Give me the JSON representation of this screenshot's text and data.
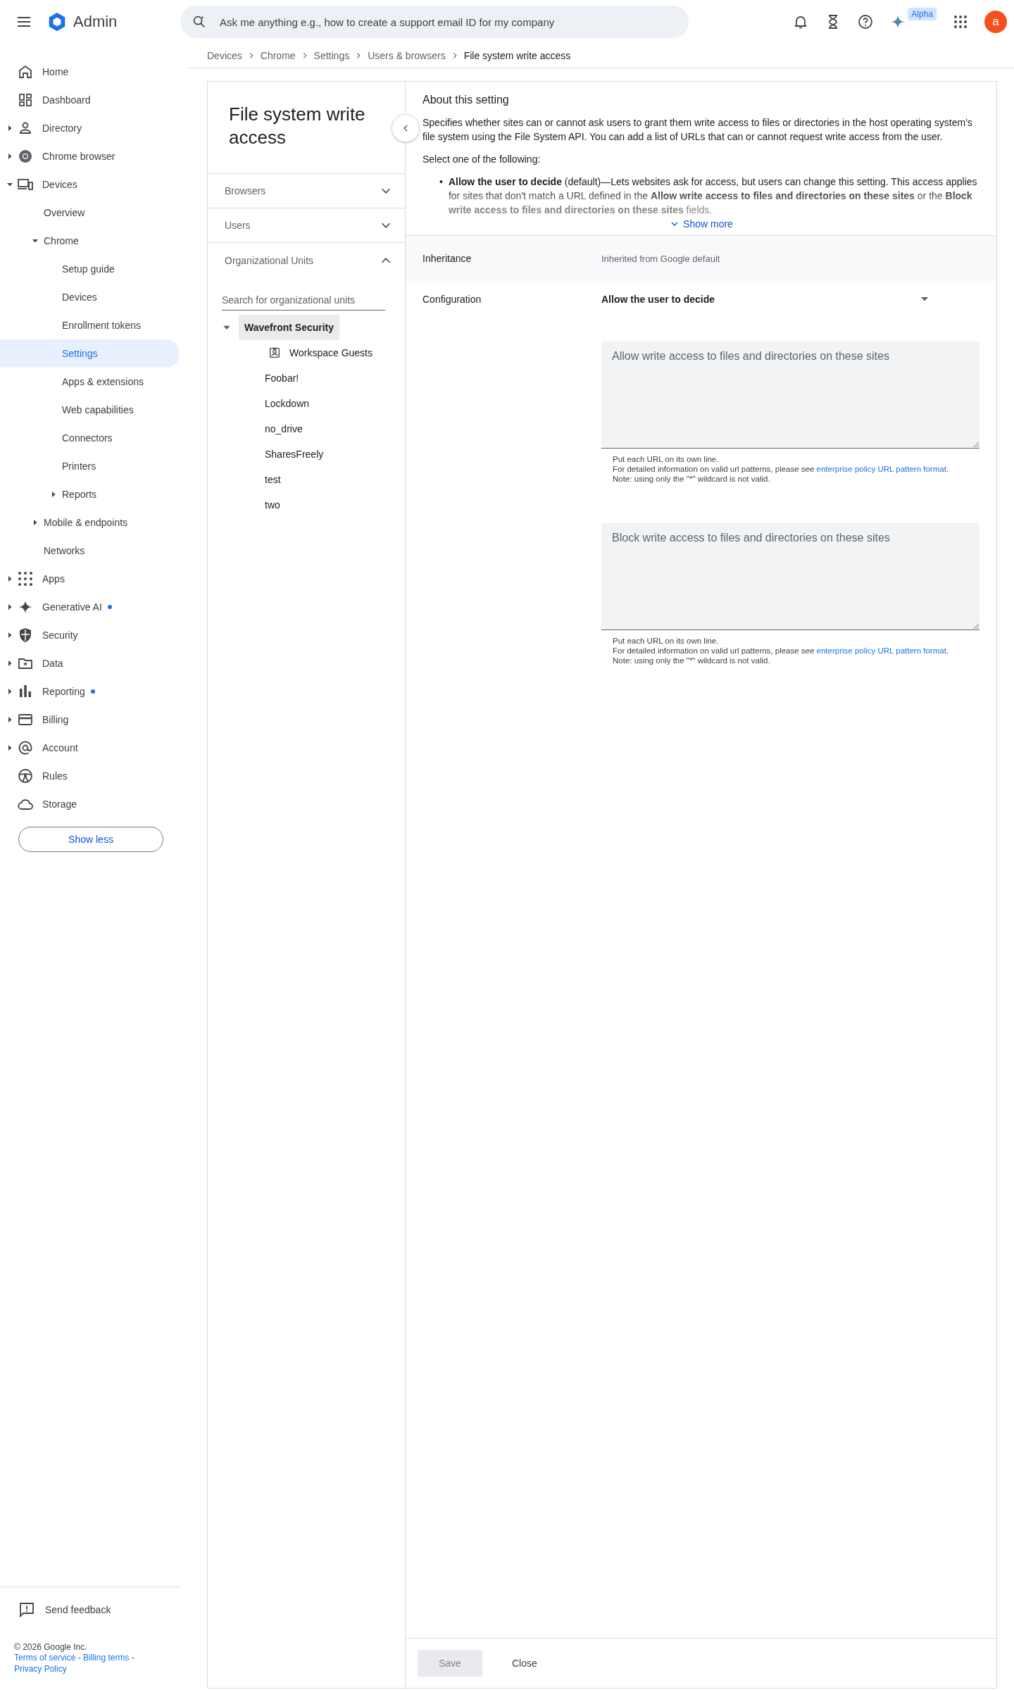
{
  "header": {
    "app_name": "Admin",
    "search": {
      "placeholder": "Ask me anything e.g., how to create a support email ID for my company"
    },
    "badge": "Alpha",
    "avatar_letter": "a"
  },
  "breadcrumb": [
    {
      "label": "Devices",
      "current": false
    },
    {
      "label": "Chrome",
      "current": false
    },
    {
      "label": "Settings",
      "current": false
    },
    {
      "label": "Users & browsers",
      "current": false
    },
    {
      "label": "File system write access",
      "current": true
    }
  ],
  "sidebar": {
    "items": [
      {
        "label": "Home",
        "expandable": false,
        "expanded": false,
        "selected": false,
        "dot": false
      },
      {
        "label": "Dashboard",
        "expandable": false,
        "expanded": false,
        "selected": false,
        "dot": false
      },
      {
        "label": "Directory",
        "expandable": true,
        "expanded": false,
        "selected": false,
        "dot": false
      },
      {
        "label": "Chrome browser",
        "expandable": true,
        "expanded": false,
        "selected": false,
        "dot": false
      },
      {
        "label": "Devices",
        "expandable": true,
        "expanded": true,
        "selected": false,
        "dot": false,
        "children": [
          {
            "label": "Overview",
            "expandable": false,
            "expanded": false,
            "selected": false,
            "dot": false
          },
          {
            "label": "Chrome",
            "expandable": true,
            "expanded": true,
            "selected": false,
            "dot": false,
            "children": [
              {
                "label": "Setup guide",
                "expandable": false,
                "expanded": false,
                "selected": false,
                "dot": false
              },
              {
                "label": "Devices",
                "expandable": false,
                "expanded": false,
                "selected": false,
                "dot": false
              },
              {
                "label": "Enrollment tokens",
                "expandable": false,
                "expanded": false,
                "selected": false,
                "dot": false
              },
              {
                "label": "Settings",
                "expandable": false,
                "expanded": false,
                "selected": true,
                "dot": false
              },
              {
                "label": "Apps & extensions",
                "expandable": false,
                "expanded": false,
                "selected": false,
                "dot": false
              },
              {
                "label": "Web capabilities",
                "expandable": false,
                "expanded": false,
                "selected": false,
                "dot": false
              },
              {
                "label": "Connectors",
                "expandable": false,
                "expanded": false,
                "selected": false,
                "dot": false
              },
              {
                "label": "Printers",
                "expandable": false,
                "expanded": false,
                "selected": false,
                "dot": false
              },
              {
                "label": "Reports",
                "expandable": true,
                "expanded": false,
                "selected": false,
                "dot": false
              }
            ]
          },
          {
            "label": "Mobile & endpoints",
            "expandable": true,
            "expanded": false,
            "selected": false,
            "dot": false
          },
          {
            "label": "Networks",
            "expandable": false,
            "expanded": false,
            "selected": false,
            "dot": false
          }
        ]
      },
      {
        "label": "Apps",
        "expandable": true,
        "expanded": false,
        "selected": false,
        "dot": false
      },
      {
        "label": "Generative AI",
        "expandable": true,
        "expanded": false,
        "selected": false,
        "dot": true
      },
      {
        "label": "Security",
        "expandable": true,
        "expanded": false,
        "selected": false,
        "dot": false
      },
      {
        "label": "Data",
        "expandable": true,
        "expanded": false,
        "selected": false,
        "dot": false
      },
      {
        "label": "Reporting",
        "expandable": true,
        "expanded": false,
        "selected": false,
        "dot": true
      },
      {
        "label": "Billing",
        "expandable": true,
        "expanded": false,
        "selected": false,
        "dot": false
      },
      {
        "label": "Account",
        "expandable": true,
        "expanded": false,
        "selected": false,
        "dot": false
      },
      {
        "label": "Rules",
        "expandable": false,
        "expanded": false,
        "selected": false,
        "dot": false
      },
      {
        "label": "Storage",
        "expandable": false,
        "expanded": false,
        "selected": false,
        "dot": false
      }
    ],
    "show_less": "Show less",
    "feedback": "Send feedback",
    "copyright": "© 2026 Google Inc.",
    "links": [
      "Terms of service",
      "Billing terms",
      "Privacy Policy"
    ],
    "link_separator": "-"
  },
  "setting_panel": {
    "title": "File system write access",
    "sections": [
      {
        "label": "Browsers",
        "expanded": false
      },
      {
        "label": "Users",
        "expanded": false
      },
      {
        "label": "Organizational Units",
        "expanded": true
      }
    ],
    "ou_search": {
      "placeholder": "Search for organizational units"
    },
    "ou_tree": {
      "label": "Wavefront Security",
      "expanded": true,
      "selected": true,
      "children": [
        {
          "label": "Workspace Guests",
          "kind": "guest",
          "selected": false
        },
        {
          "label": "Foobar!",
          "kind": "unit",
          "selected": false
        },
        {
          "label": "Lockdown",
          "kind": "unit",
          "selected": false
        },
        {
          "label": "no_drive",
          "kind": "unit",
          "selected": false
        },
        {
          "label": "SharesFreely",
          "kind": "unit",
          "selected": false
        },
        {
          "label": "test",
          "kind": "unit",
          "selected": false
        },
        {
          "label": "two",
          "kind": "unit",
          "selected": false
        }
      ]
    }
  },
  "about": {
    "title": "About this setting",
    "description": "Specifies whether sites can or cannot ask users to grant them write access to files or directories in the host operating system's file system using the File System API. You can add a list of URLs that can or cannot request write access from the user.",
    "intro": "Select one of the following:",
    "bullet": "•",
    "option": "**Allow the user to decide** (default)—Lets websites ask for access, but users can change this setting. This access applies for sites that don't match a URL defined in the **Allow write access to files and directories on these sites** or the **Block write access to files and directories on these sites** fields.",
    "show_more": "Show more"
  },
  "inheritance": {
    "label": "Inheritance",
    "value": "Inherited from Google default"
  },
  "configuration": {
    "label": "Configuration",
    "value": "Allow the user to decide",
    "fields": [
      {
        "placeholder": "Allow write access to files and directories on these sites",
        "help_1": "Put each URL on its own line.",
        "help_2": "For detailed information on valid url patterns, please see ",
        "link": "enterprise policy URL pattern format",
        "help_2_end": ".",
        "help_3": "Note: using only the \"*\" wildcard is not valid."
      },
      {
        "placeholder": "Block write access to files and directories on these sites",
        "help_1": "Put each URL on its own line.",
        "help_2": "For detailed information on valid url patterns, please see ",
        "link": "enterprise policy URL pattern format",
        "help_2_end": ".",
        "help_3": "Note: using only the \"*\" wildcard is not valid."
      }
    ]
  },
  "actions": [
    {
      "label": "Save",
      "disabled": true
    },
    {
      "label": "Close",
      "disabled": false
    }
  ]
}
